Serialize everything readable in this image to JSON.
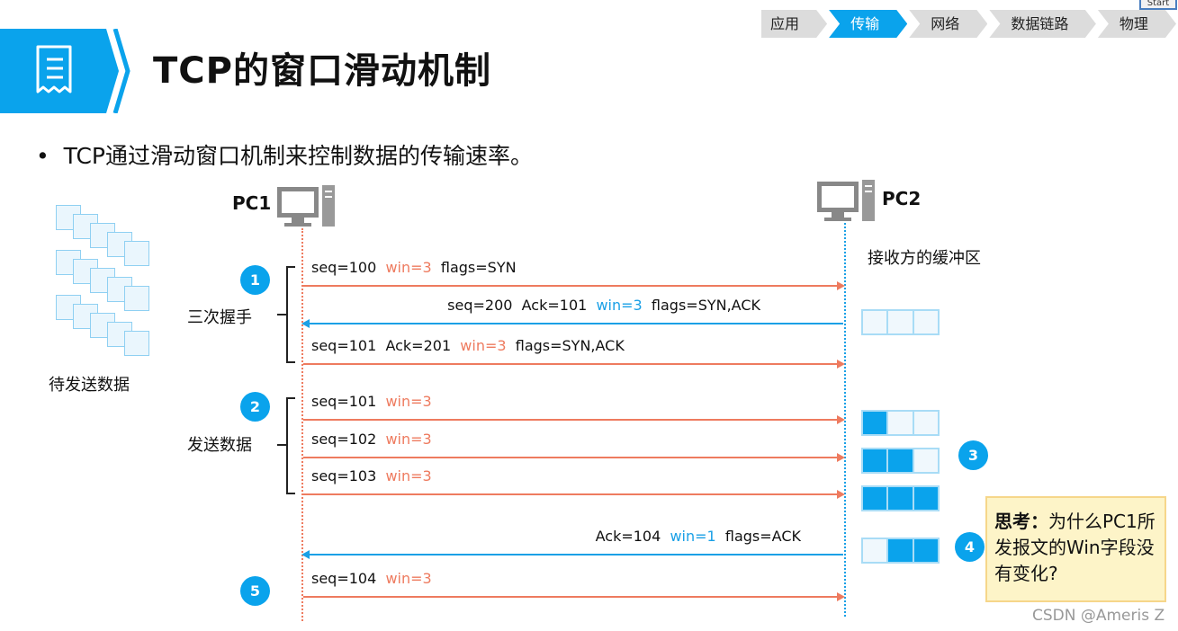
{
  "nav": {
    "items": [
      "应用层",
      "传输层",
      "网络层",
      "数据链路层",
      "物理层"
    ],
    "active": 1,
    "start_label": "Start"
  },
  "header": {
    "title": "TCP的窗口滑动机制",
    "icon": "receipt-icon"
  },
  "bullet": "TCP通过滑动窗口机制来控制数据的传输速率。",
  "pc1": "PC1",
  "pc2": "PC2",
  "pending_label": "待发送数据",
  "buffer_label": "接收方的缓冲区",
  "handshake_label": "三次握手",
  "send_label": "发送数据",
  "steps": [
    "1",
    "2",
    "3",
    "4",
    "5"
  ],
  "messages": [
    {
      "dir": "right",
      "pre": "seq=100  ",
      "win": "win=3",
      "post": "  flags=SYN"
    },
    {
      "dir": "left",
      "pre": "seq=200  Ack=101  ",
      "win": "win=3",
      "post": "  flags=SYN,ACK"
    },
    {
      "dir": "right",
      "pre": "seq=101  Ack=201  ",
      "win": "win=3",
      "post": "  flags=SYN,ACK"
    },
    {
      "dir": "right",
      "pre": "seq=101  ",
      "win": "win=3",
      "post": ""
    },
    {
      "dir": "right",
      "pre": "seq=102  ",
      "win": "win=3",
      "post": ""
    },
    {
      "dir": "right",
      "pre": "seq=103  ",
      "win": "win=3",
      "post": ""
    },
    {
      "dir": "left",
      "pre": "Ack=104  ",
      "win": "win=1",
      "post": "  flags=ACK"
    },
    {
      "dir": "right",
      "pre": "seq=104  ",
      "win": "win=3",
      "post": ""
    }
  ],
  "buffers": [
    [
      0,
      0,
      0
    ],
    [
      1,
      0,
      0
    ],
    [
      1,
      1,
      0
    ],
    [
      1,
      1,
      1
    ],
    [
      0,
      1,
      1
    ]
  ],
  "think": {
    "bold": "思考：",
    "text": "为什么PC1所发报文的Win字段没有变化?"
  },
  "watermark": "CSDN @Ameris Z",
  "colors": {
    "accent": "#0aa3ec",
    "send_arrow": "#ee7b5f",
    "ack_arrow": "#1aa0e6"
  }
}
